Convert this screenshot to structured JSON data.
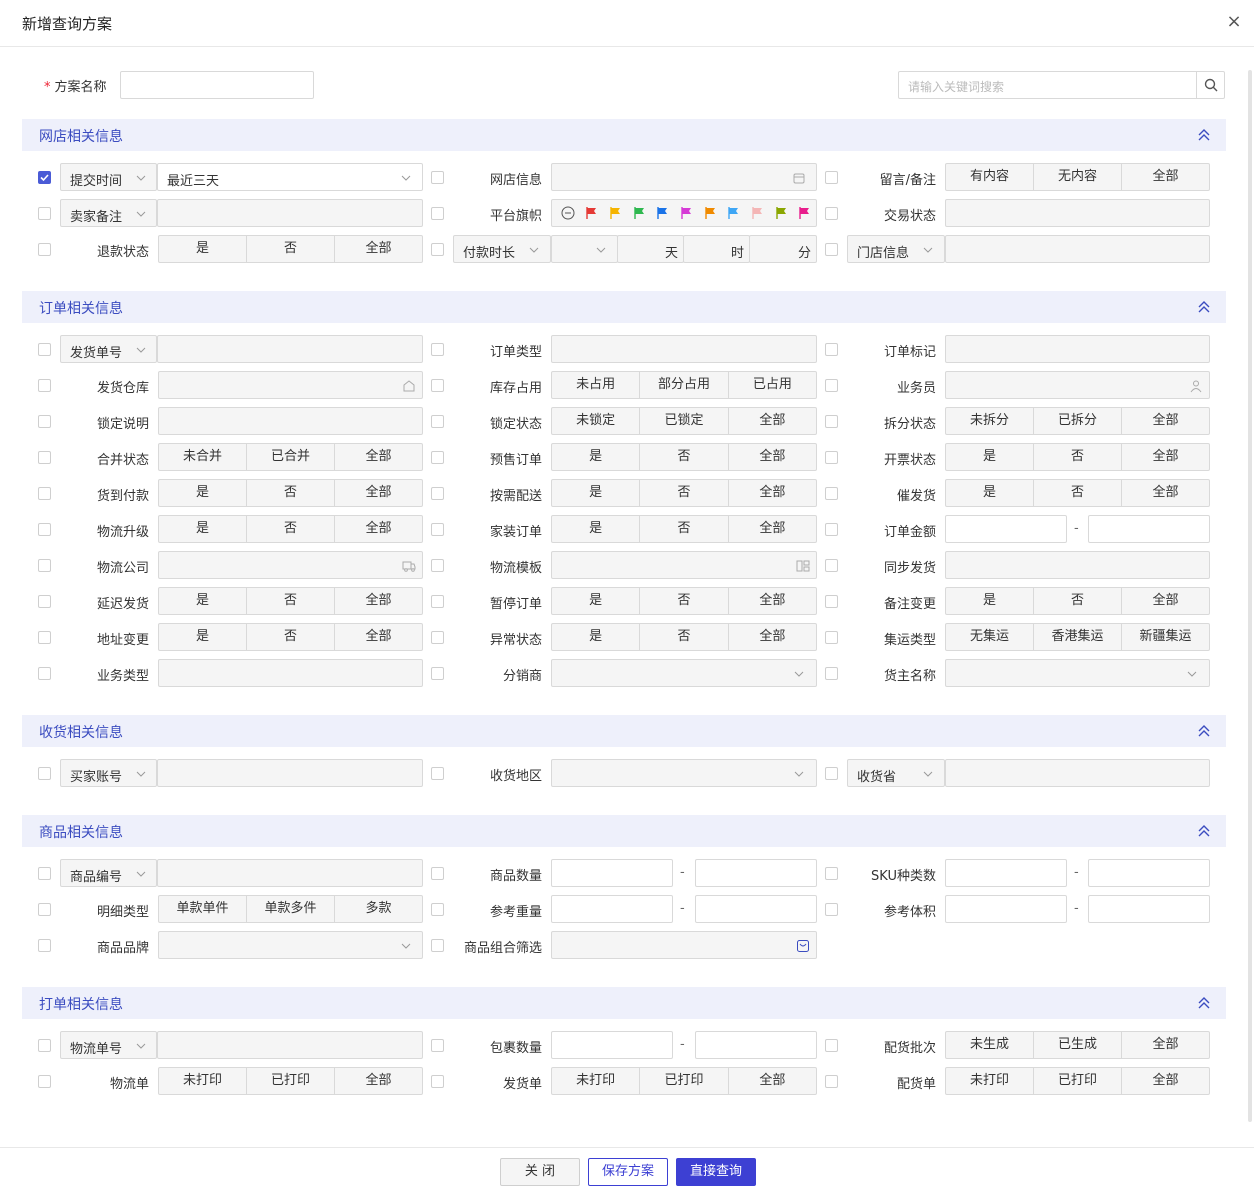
{
  "dialog": {
    "title": "新增查询方案",
    "close_icon": "×"
  },
  "scheme": {
    "required_mark": "*",
    "name_label": "方案名称",
    "search_placeholder": "请输入关键词搜索"
  },
  "sections": {
    "shop": "网店相关信息",
    "order": "订单相关信息",
    "receive": "收货相关信息",
    "goods": "商品相关信息",
    "print": "打单相关信息"
  },
  "shop": {
    "submit_time_select": "提交时间",
    "submit_time_value": "最近三天",
    "shop_info": "网店信息",
    "remark_label": "留言/备注",
    "remark_opts": [
      "有内容",
      "无内容",
      "全部"
    ],
    "seller_note_select": "卖家备注",
    "flag_label": "平台旗帜",
    "flag_colors": [
      "#e53935",
      "#f5b400",
      "#2eb84f",
      "#1a73e8",
      "#d63ad6",
      "#f08a00",
      "#3ea6f5",
      "#f4b6b6",
      "#8aa600",
      "#e81e8c"
    ],
    "trade_status": "交易状态",
    "refund_label": "退款状态",
    "refund_opts": [
      "是",
      "否",
      "全部"
    ],
    "pay_time_select": "付款时长",
    "pay_units": [
      "天",
      "时",
      "分"
    ],
    "store_select": "门店信息"
  },
  "order": {
    "ship_no_select": "发货单号",
    "order_type": "订单类型",
    "order_mark": "订单标记",
    "warehouse": "发货仓库",
    "stock_label": "库存占用",
    "stock_opts": [
      "未占用",
      "部分占用",
      "已占用"
    ],
    "salesman": "业务员",
    "lock_desc": "锁定说明",
    "lock_label": "锁定状态",
    "lock_opts": [
      "未锁定",
      "已锁定",
      "全部"
    ],
    "split_label": "拆分状态",
    "split_opts": [
      "未拆分",
      "已拆分",
      "全部"
    ],
    "merge_label": "合并状态",
    "merge_opts": [
      "未合并",
      "已合并",
      "全部"
    ],
    "presale_label": "预售订单",
    "presale_opts": [
      "是",
      "否",
      "全部"
    ],
    "invoice_label": "开票状态",
    "invoice_opts": [
      "是",
      "否",
      "全部"
    ],
    "cod_label": "货到付款",
    "cod_opts": [
      "是",
      "否",
      "全部"
    ],
    "ondemand_label": "按需配送",
    "ondemand_opts": [
      "是",
      "否",
      "全部"
    ],
    "urge_label": "催发货",
    "urge_opts": [
      "是",
      "否",
      "全部"
    ],
    "upgrade_label": "物流升级",
    "upgrade_opts": [
      "是",
      "否",
      "全部"
    ],
    "homeinstall_label": "家装订单",
    "homeinstall_opts": [
      "是",
      "否",
      "全部"
    ],
    "amount_label": "订单金额",
    "range_dash": "-",
    "logistics_company": "物流公司",
    "logistics_template": "物流模板",
    "sync_ship": "同步发货",
    "delay_label": "延迟发货",
    "delay_opts": [
      "是",
      "否",
      "全部"
    ],
    "pause_label": "暂停订单",
    "pause_opts": [
      "是",
      "否",
      "全部"
    ],
    "note_change_label": "备注变更",
    "note_change_opts": [
      "是",
      "否",
      "全部"
    ],
    "addr_change_label": "地址变更",
    "addr_change_opts": [
      "是",
      "否",
      "全部"
    ],
    "abnormal_label": "异常状态",
    "abnormal_opts": [
      "是",
      "否",
      "全部"
    ],
    "consol_label": "集运类型",
    "consol_opts": [
      "无集运",
      "香港集运",
      "新疆集运"
    ],
    "biz_type": "业务类型",
    "distributor": "分销商",
    "owner": "货主名称"
  },
  "receive": {
    "buyer_select": "买家账号",
    "region": "收货地区",
    "province_select": "收货省"
  },
  "goods": {
    "code_select": "商品编号",
    "qty": "商品数量",
    "sku_kinds": "SKU种类数",
    "detail_label": "明细类型",
    "detail_opts": [
      "单款单件",
      "单款多件",
      "多款"
    ],
    "weight": "参考重量",
    "volume": "参考体积",
    "brand": "商品品牌",
    "combo": "商品组合筛选"
  },
  "print": {
    "tracking_select": "物流单号",
    "pkg_qty": "包裹数量",
    "batch_label": "配货批次",
    "batch_opts": [
      "未生成",
      "已生成",
      "全部"
    ],
    "waybill_label": "物流单",
    "waybill_opts": [
      "未打印",
      "已打印",
      "全部"
    ],
    "ship_label": "发货单",
    "ship_opts": [
      "未打印",
      "已打印",
      "全部"
    ],
    "pick_label": "配货单",
    "pick_opts": [
      "未打印",
      "已打印",
      "全部"
    ]
  },
  "footer": {
    "close": "关 闭",
    "save": "保存方案",
    "query": "直接查询"
  },
  "colors": {
    "accent": "#4a5bd6",
    "section_bg": "#eef0fb",
    "section_text": "#3b4cc0",
    "primary_btn": "#3d40d3"
  }
}
